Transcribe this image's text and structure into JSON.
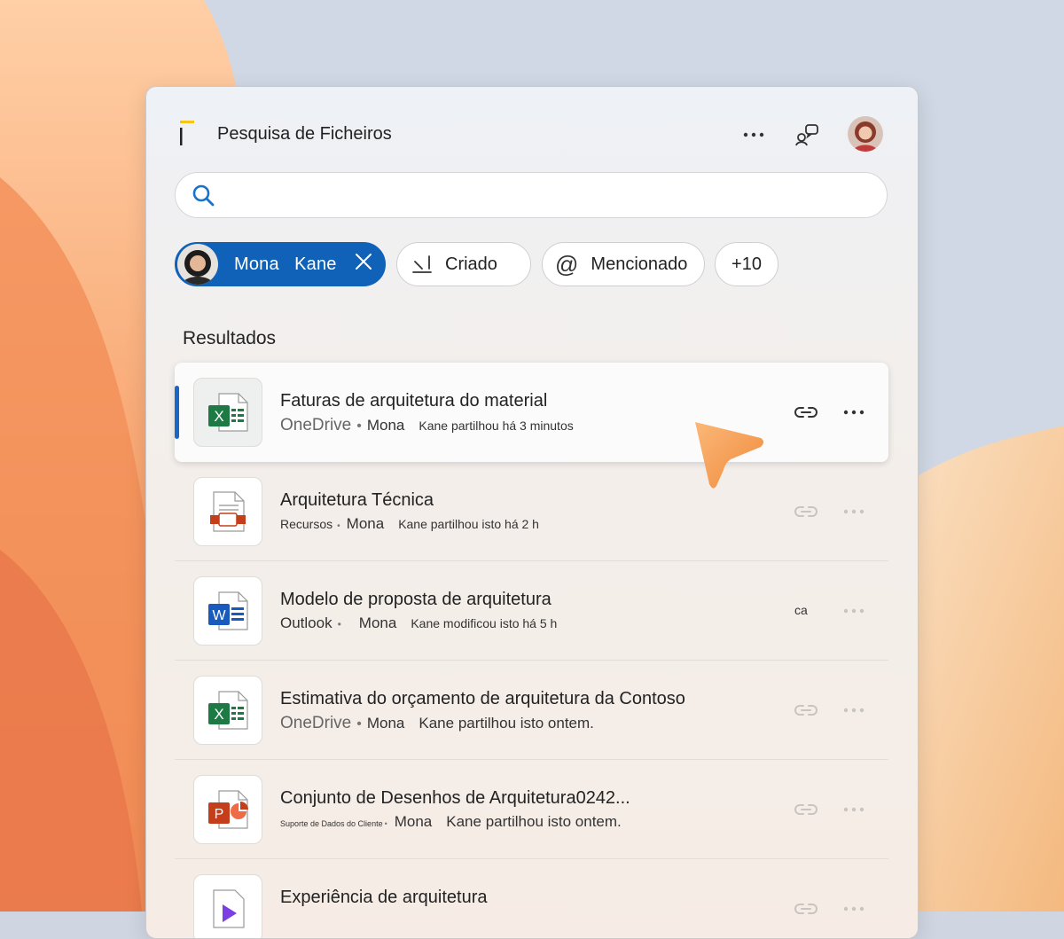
{
  "header": {
    "title": "Pesquisa de Ficheiros",
    "more_icon": "ellipsis-icon",
    "feedback_icon": "feedback-icon",
    "avatar": "user-avatar"
  },
  "search": {
    "value": "",
    "placeholder": ""
  },
  "filters": {
    "person": {
      "first": "Mona",
      "last": "Kane"
    },
    "created": "Criado",
    "mentioned": "Mencionado",
    "more": "+10"
  },
  "section": {
    "title": "Resultados"
  },
  "results": [
    {
      "name": "Faturas de arquitetura do material",
      "source": "OneDrive",
      "who": "Mona",
      "activity": "Kane partilhou há 3 minutos",
      "type": "excel"
    },
    {
      "name": "Arquitetura Técnica",
      "source": "Recursos",
      "who": "Mona",
      "activity": "Kane partilhou isto há 2 h",
      "type": "document"
    },
    {
      "name": "Modelo de proposta de arquitetura",
      "source": "Outlook",
      "who": "Mona",
      "activity": "Kane modificou isto há 5 h",
      "type": "word",
      "action_text": "ca"
    },
    {
      "name": "Estimativa do orçamento de arquitetura da Contoso",
      "source": "OneDrive",
      "who": "Mona",
      "activity": "Kane partilhou isto ontem.",
      "type": "excel"
    },
    {
      "name": "Conjunto de Desenhos de Arquitetura0242...",
      "source": "Suporte de Dados do Cliente",
      "who": "Mona",
      "activity": "Kane partilhou isto ontem.",
      "type": "powerpoint"
    },
    {
      "name": "Experiência de arquitetura",
      "type": "video"
    }
  ],
  "colors": {
    "accent": "#0f62b8",
    "excel": "#1d7a45",
    "word": "#185abd",
    "powerpoint": "#c43e1c",
    "pointer": "#f39a4a"
  }
}
